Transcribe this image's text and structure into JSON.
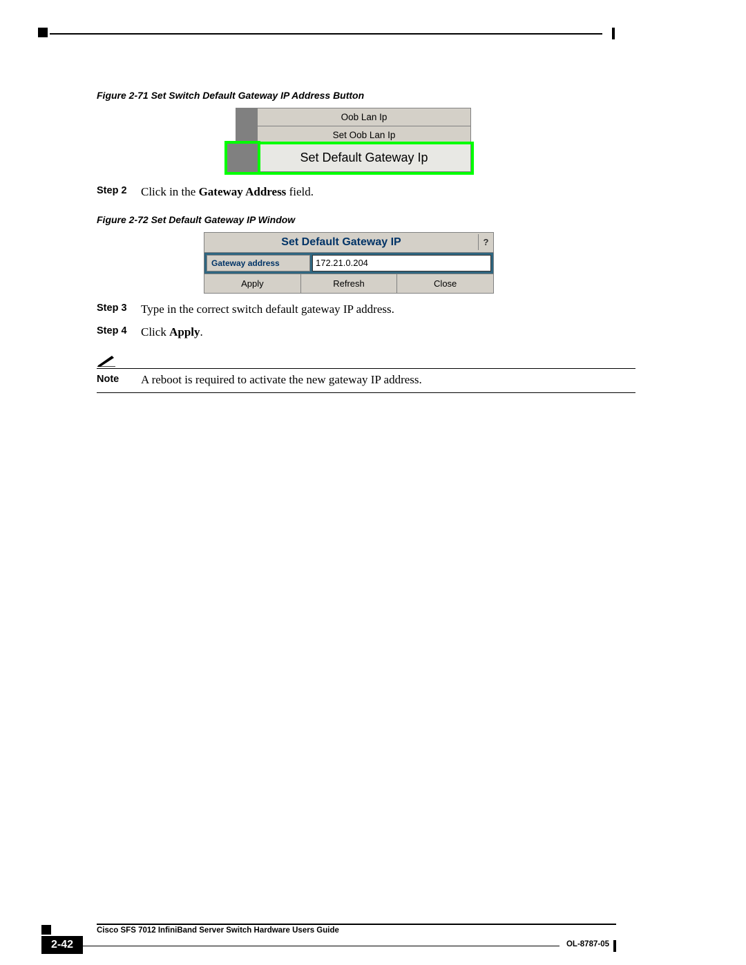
{
  "figure71": {
    "label": "Figure 2-71   Set Switch Default Gateway IP Address Button",
    "rows": [
      "Oob Lan Ip",
      "Set Oob Lan Ip",
      "Set Default Gateway Ip"
    ]
  },
  "step2": {
    "label": "Step 2",
    "text_prefix": "Click in the ",
    "text_bold": "Gateway Address",
    "text_suffix": " field."
  },
  "figure72": {
    "label": "Figure 2-72   Set Default Gateway IP Window",
    "title": "Set Default Gateway IP",
    "help": "?",
    "field_label": "Gateway address",
    "field_value": "172.21.0.204",
    "buttons": [
      "Apply",
      "Refresh",
      "Close"
    ]
  },
  "step3": {
    "label": "Step 3",
    "text": "Type in the correct switch default gateway IP address."
  },
  "step4": {
    "label": "Step 4",
    "text_prefix": "Click ",
    "text_bold": "Apply",
    "text_suffix": "."
  },
  "note": {
    "label": "Note",
    "text": "A reboot is required to activate the new gateway IP address."
  },
  "footer": {
    "title": "Cisco SFS 7012 InfiniBand Server Switch Hardware Users Guide",
    "page": "2-42",
    "docid": "OL-8787-05"
  }
}
